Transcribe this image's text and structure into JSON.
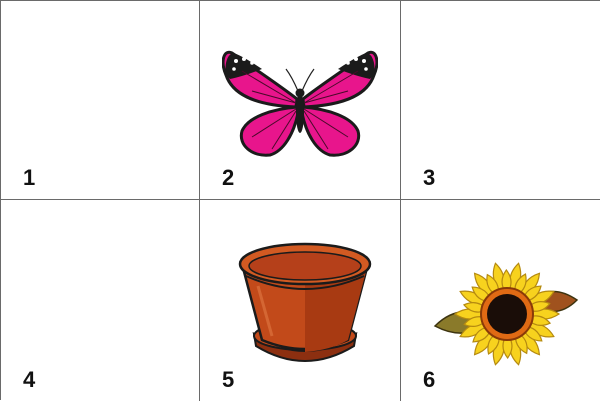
{
  "cells": [
    {
      "number": "1",
      "icon": null
    },
    {
      "number": "2",
      "icon": "butterfly-icon"
    },
    {
      "number": "3",
      "icon": null
    },
    {
      "number": "4",
      "icon": null
    },
    {
      "number": "5",
      "icon": "flower-pot-icon"
    },
    {
      "number": "6",
      "icon": "sunflower-icon"
    }
  ],
  "colors": {
    "grid_line": "#6a6a6a",
    "butterfly_wing": "#e8158c",
    "pot": "#c24a1a",
    "sunflower_petal": "#f7d21e",
    "sunflower_center": "#1a0d08"
  }
}
